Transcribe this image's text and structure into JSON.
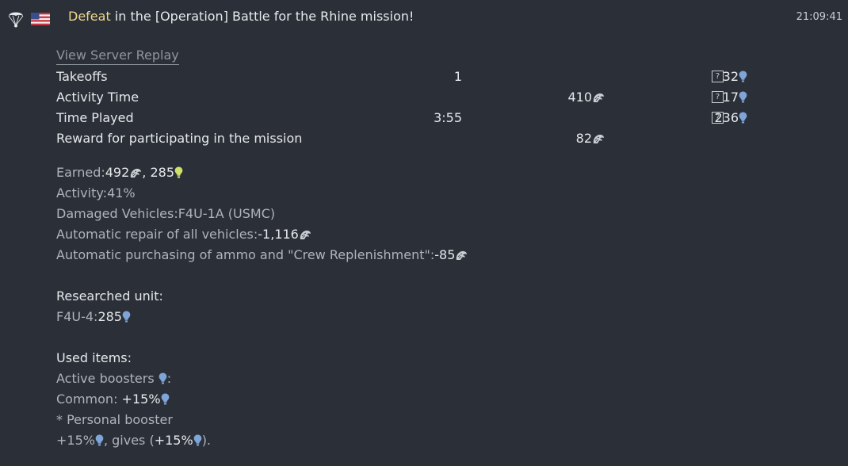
{
  "header": {
    "result_word": "Defeat",
    "title_rest": " in the [Operation] Battle for the Rhine mission!",
    "time": "21:09:41"
  },
  "replay_link": "View Server Replay",
  "stats": [
    {
      "label": "Takeoffs",
      "c1": "1",
      "c2": "",
      "c3": "32"
    },
    {
      "label": "Activity Time",
      "c1": "",
      "c2": "410",
      "c3": "17"
    },
    {
      "label": "Time Played",
      "c1": "3:55",
      "c2": "",
      "c3": "236"
    },
    {
      "label": "Reward for participating in the mission",
      "c1": "",
      "c2": "82",
      "c3": ""
    }
  ],
  "help_glyph": "?",
  "earned": {
    "label": "Earned: ",
    "lions": "492",
    "sep": ", ",
    "rp": "285"
  },
  "activity": {
    "label": "Activity: ",
    "value": "41%"
  },
  "damaged": {
    "label": "Damaged Vehicles: ",
    "value": "F4U-1A (USMC)"
  },
  "repair": {
    "label": "Automatic repair of all vehicles: ",
    "value": "-1,116"
  },
  "ammo": {
    "label": "Automatic purchasing of ammo and \"Crew Replenishment\": ",
    "value": "-85"
  },
  "researched": {
    "heading": "Researched unit:",
    "unit": "F4U-4: ",
    "value": "285"
  },
  "used_items": {
    "heading": "Used items:",
    "active": "Active boosters ",
    "colon": ":",
    "common_label": "Common: ",
    "common_value": "+15%",
    "personal": "* Personal booster",
    "personal_value": "+15%",
    "gives_label": ", gives (",
    "gives_value": "+15%",
    "gives_end": ")."
  },
  "colors": {
    "accent_defeat": "#f0d78a",
    "rp_blue": "#7fa5d8",
    "rp_green": "#cfe06a",
    "lion": "#c9cdd2"
  }
}
